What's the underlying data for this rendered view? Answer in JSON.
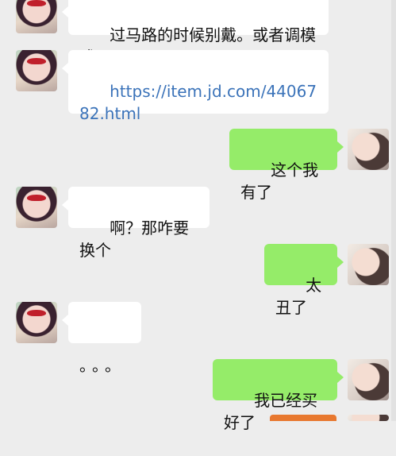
{
  "chat": {
    "messages": [
      {
        "side": "left",
        "text": "过马路的时候别戴。或者调模式"
      },
      {
        "side": "left",
        "text": "https://item.jd.com/4406782.html",
        "is_link": true
      },
      {
        "side": "right",
        "text": "这个我有了"
      },
      {
        "side": "left",
        "text": "啊？那咋要换个"
      },
      {
        "side": "right",
        "text": "太丑了"
      },
      {
        "side": "left",
        "text": "。。。"
      },
      {
        "side": "right",
        "text": "我已经买好了"
      }
    ]
  },
  "colors": {
    "background": "#ededed",
    "bubble_left": "#ffffff",
    "bubble_right": "#95ec69",
    "link": "#3b73b9"
  }
}
